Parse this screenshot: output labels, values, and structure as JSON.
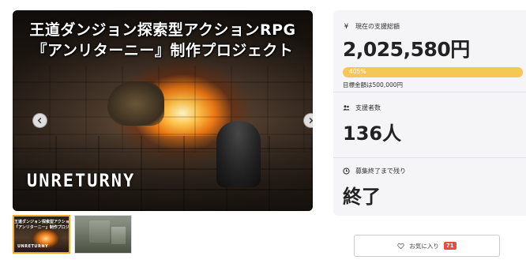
{
  "hero": {
    "title_line1": "王道ダンジョン探索型アクションRPG",
    "title_line2": "『アンリターニー』制作プロジェクト",
    "logo_text": "UNRETURNY"
  },
  "thumbnails": [
    {
      "line1": "王道ダンジョン探索型アクションRPG",
      "line2": "『アンリターニー』制作プロジェクト",
      "logo": "UNRETURNY",
      "selected": true
    },
    {
      "selected": false
    }
  ],
  "stats": {
    "funds_label": "現在の支援総額",
    "funds_icon": "yen-icon",
    "funds_value": "2,025,580円",
    "progress_percent_text": "405%",
    "progress_fraction": 4.05,
    "goal_text": "目標金額は500,000円",
    "backers_label": "支援者数",
    "backers_icon": "people-icon",
    "backers_value": "136人",
    "time_label": "募集終了まで残り",
    "time_icon": "clock-icon",
    "time_value": "終了"
  },
  "favorite": {
    "label": "お気に入り",
    "count": "71",
    "icon": "heart-icon"
  },
  "colors": {
    "progress": "#f6c757",
    "panel_bg": "#f5f5f7",
    "badge": "#e74c3c",
    "thumb_selected_border": "#f5a623"
  }
}
